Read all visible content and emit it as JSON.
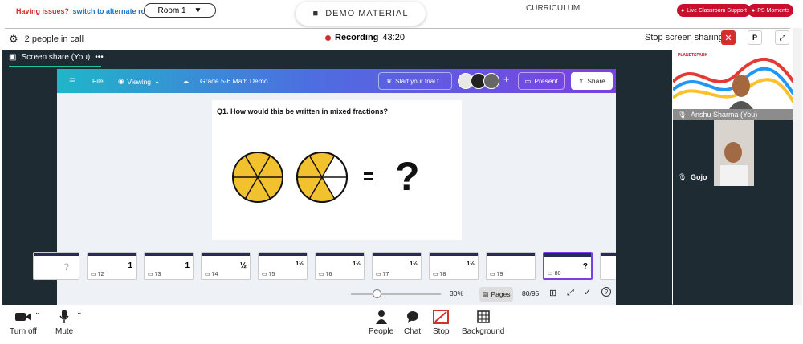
{
  "topbar": {
    "issue_text": "Having issues?",
    "alternate_link": "switch to alternate room",
    "room_label": "Room 1",
    "demo_material": "DEMO MATERIAL",
    "curriculum": "CURRICULUM",
    "live_support": "Live Classroom Support",
    "ps_moments": "PS Moments"
  },
  "callbar": {
    "people": "2 people in call",
    "recording_label": "Recording",
    "recording_time": "43:20",
    "stop_share": "Stop screen sharing",
    "p_label": "P"
  },
  "share": {
    "title": "Screen share (You)"
  },
  "canva": {
    "file": "File",
    "viewing": "Viewing",
    "doc_title": "Grade 5-6 Math Demo ...",
    "trial": "Start your trial f...",
    "present": "Present",
    "share": "Share",
    "question": "Q1. How would this be written in mixed fractions?",
    "zoom": "30%",
    "pages_label": "Pages",
    "page_count": "80/95",
    "thumbs": [
      {
        "num": "72",
        "eq": "1"
      },
      {
        "num": "73",
        "eq": "1"
      },
      {
        "num": "74",
        "eq": "½"
      },
      {
        "num": "75",
        "eq": "1½"
      },
      {
        "num": "76",
        "eq": "1½"
      },
      {
        "num": "77",
        "eq": "1½"
      },
      {
        "num": "78",
        "eq": "1½"
      },
      {
        "num": "79",
        "eq": ""
      },
      {
        "num": "80",
        "eq": "?"
      }
    ]
  },
  "videos": {
    "teacher_name": "Anshu Sharma (You)",
    "student_name": "Gojo",
    "brand": "PLANETSPARK"
  },
  "bottombar": {
    "turn_off": "Turn off",
    "mute": "Mute",
    "people": "People",
    "chat": "Chat",
    "stop": "Stop",
    "background": "Background"
  },
  "colors": {
    "accent_red": "#d32f2f",
    "canva_purple": "#7d3fe0",
    "pie_yellow": "#f2c12e"
  }
}
